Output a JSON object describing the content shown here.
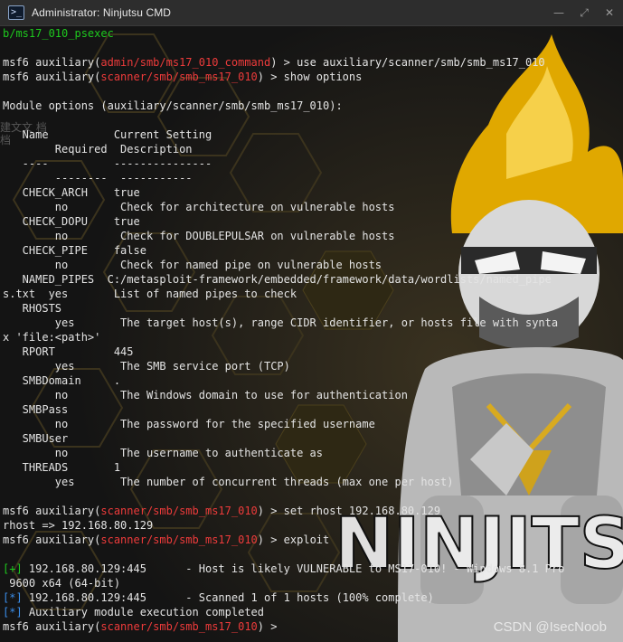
{
  "window": {
    "title": "Administrator: Ninjutsu CMD",
    "icon": "terminal-icon",
    "minimize_glyph": "—",
    "maximize_glyph": "⤢",
    "close_glyph": "✕"
  },
  "colors": {
    "green": "#1ec91e",
    "red": "#ee3b3b",
    "blue": "#3b8eea",
    "text": "#e4e4e4",
    "accent_gold": "#f2b705"
  },
  "background": {
    "letters": "NINJITS"
  },
  "terminal": {
    "lines": [
      [
        {
          "t": "b/ms17_010_psexec",
          "c": "green"
        }
      ],
      [],
      [
        {
          "t": "msf6 auxiliary(",
          "c": "white"
        },
        {
          "t": "admin/smb/ms17_010_command",
          "c": "red"
        },
        {
          "t": ") > use auxiliary/scanner/smb/smb_ms17_010",
          "c": "white"
        }
      ],
      [
        {
          "t": "msf6 auxiliary(",
          "c": "white"
        },
        {
          "t": "scanner/smb/smb_ms17_010",
          "c": "red"
        },
        {
          "t": ") > show options",
          "c": "white"
        }
      ],
      [],
      [
        {
          "t": "Module options (auxiliary/scanner/smb/smb_ms17_010):",
          "c": "white"
        }
      ],
      [],
      [
        {
          "t": "   Name          Current Setting",
          "c": "white"
        }
      ],
      [
        {
          "t": "        Required  Description",
          "c": "white"
        }
      ],
      [
        {
          "t": "   ----          ---------------",
          "c": "white"
        }
      ],
      [
        {
          "t": "        --------  -----------",
          "c": "white"
        }
      ],
      [
        {
          "t": "   CHECK_ARCH    true",
          "c": "white"
        }
      ],
      [
        {
          "t": "        no        Check for architecture on vulnerable hosts",
          "c": "white"
        }
      ],
      [
        {
          "t": "   CHECK_DOPU    true",
          "c": "white"
        }
      ],
      [
        {
          "t": "        no        Check for DOUBLEPULSAR on vulnerable hosts",
          "c": "white"
        }
      ],
      [
        {
          "t": "   CHECK_PIPE    false",
          "c": "white"
        }
      ],
      [
        {
          "t": "        no        Check for named pipe on vulnerable hosts",
          "c": "white"
        }
      ],
      [
        {
          "t": "   NAMED_PIPES  C:/metasploit-framework/embedded/framework/data/wordlists/named_pipe",
          "c": "white"
        }
      ],
      [
        {
          "t": "s.txt  yes       List of named pipes to check",
          "c": "white"
        }
      ],
      [
        {
          "t": "   RHOSTS",
          "c": "white"
        }
      ],
      [
        {
          "t": "        yes       The target host(s), range CIDR identifier, or hosts file with synta",
          "c": "white"
        }
      ],
      [
        {
          "t": "x 'file:<path>'",
          "c": "white"
        }
      ],
      [
        {
          "t": "   RPORT         445",
          "c": "white"
        }
      ],
      [
        {
          "t": "        yes       The SMB service port (TCP)",
          "c": "white"
        }
      ],
      [
        {
          "t": "   SMBDomain     .",
          "c": "white"
        }
      ],
      [
        {
          "t": "        no        The Windows domain to use for authentication",
          "c": "white"
        }
      ],
      [
        {
          "t": "   SMBPass",
          "c": "white"
        }
      ],
      [
        {
          "t": "        no        The password for the specified username",
          "c": "white"
        }
      ],
      [
        {
          "t": "   SMBUser",
          "c": "white"
        }
      ],
      [
        {
          "t": "        no        The username to authenticate as",
          "c": "white"
        }
      ],
      [
        {
          "t": "   THREADS       1",
          "c": "white"
        }
      ],
      [
        {
          "t": "        yes       The number of concurrent threads (max one per host)",
          "c": "white"
        }
      ],
      [],
      [
        {
          "t": "msf6 auxiliary(",
          "c": "white"
        },
        {
          "t": "scanner/smb/smb_ms17_010",
          "c": "red"
        },
        {
          "t": ") > set rhost 192.168.80.129",
          "c": "white"
        }
      ],
      [
        {
          "t": "rhost => 192.168.80.129",
          "c": "white"
        }
      ],
      [
        {
          "t": "msf6 auxiliary(",
          "c": "white"
        },
        {
          "t": "scanner/smb/smb_ms17_010",
          "c": "red"
        },
        {
          "t": ") > exploit",
          "c": "white"
        }
      ],
      [],
      [
        {
          "t": "[+]",
          "c": "green"
        },
        {
          "t": " 192.168.80.129:445      - Host is likely VULNERABLE to MS17-010! - Windows 8.1 Pro",
          "c": "white"
        }
      ],
      [
        {
          "t": " 9600 x64 (64-bit)",
          "c": "white"
        }
      ],
      [
        {
          "t": "[*]",
          "c": "blue"
        },
        {
          "t": " 192.168.80.129:445      - Scanned 1 of 1 hosts (100% complete)",
          "c": "white"
        }
      ],
      [
        {
          "t": "[*]",
          "c": "blue"
        },
        {
          "t": " Auxiliary module execution completed",
          "c": "white"
        }
      ],
      [
        {
          "t": "msf6 auxiliary(",
          "c": "white"
        },
        {
          "t": "scanner/smb/smb_ms17_010",
          "c": "red"
        },
        {
          "t": ") > ",
          "c": "white"
        }
      ]
    ]
  },
  "overlay": {
    "ghost_text": "建文文\n档档",
    "watermark": "CSDN @IsecNoob"
  }
}
